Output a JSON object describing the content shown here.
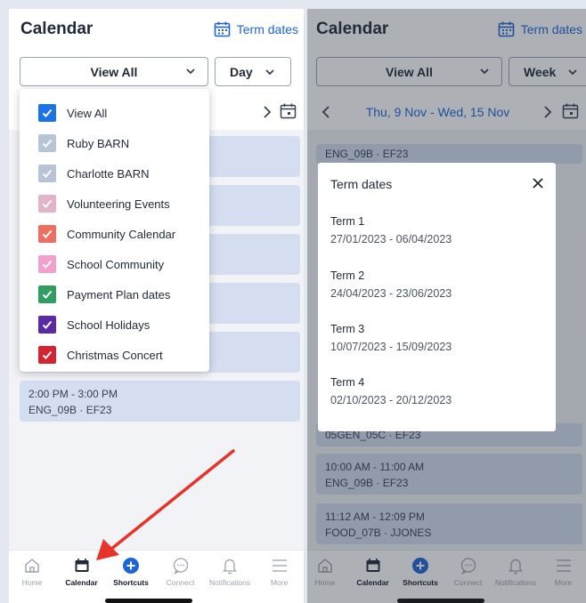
{
  "left": {
    "title": "Calendar",
    "term_link": "Term dates",
    "view_select": "View All",
    "mode_select": "Day",
    "dropdown_items": [
      {
        "label": "View All",
        "color": "#1a73e8",
        "checked": true
      },
      {
        "label": "Ruby BARN",
        "color": "#b7c3d6",
        "checked": true
      },
      {
        "label": "Charlotte BARN",
        "color": "#b7c3d6",
        "checked": true
      },
      {
        "label": "Volunteering Events",
        "color": "#e3b3c9",
        "checked": true
      },
      {
        "label": "Community Calendar",
        "color": "#ef6e60",
        "checked": true
      },
      {
        "label": "School Community",
        "color": "#f4a0cf",
        "checked": true
      },
      {
        "label": "Payment Plan dates",
        "color": "#2e9e62",
        "checked": true
      },
      {
        "label": "School Holidays",
        "color": "#5b2aa5",
        "checked": true
      },
      {
        "label": "Christmas Concert",
        "color": "#d5232f",
        "checked": true
      }
    ],
    "events": [
      {
        "time": "2:00 PM - 3:00 PM",
        "class": "ENG_09B · EF23"
      }
    ]
  },
  "right": {
    "title": "Calendar",
    "term_link": "Term dates",
    "view_select": "View All",
    "mode_select": "Week",
    "date_range": "Thu, 9 Nov - Wed, 15 Nov",
    "events": [
      {
        "time": "",
        "class": "ENG_09B · EF23"
      },
      {
        "time": "",
        "class": "05GEN_05C · EF23"
      },
      {
        "time": "10:00 AM - 11:00 AM",
        "class": "ENG_09B · EF23"
      },
      {
        "time": "11:12 AM - 12:09 PM",
        "class": "FOOD_07B · JJONES"
      }
    ],
    "modal": {
      "title": "Term dates",
      "terms": [
        {
          "name": "Term 1",
          "dates": "27/01/2023 - 06/04/2023"
        },
        {
          "name": "Term 2",
          "dates": "24/04/2023 - 23/06/2023"
        },
        {
          "name": "Term 3",
          "dates": "10/07/2023 - 15/09/2023"
        },
        {
          "name": "Term 4",
          "dates": "02/10/2023 - 20/12/2023"
        }
      ]
    }
  },
  "tabs": [
    {
      "label": "Home",
      "icon": "home-icon"
    },
    {
      "label": "Calendar",
      "icon": "calendar-icon"
    },
    {
      "label": "Shortcuts",
      "icon": "plus-circle-icon"
    },
    {
      "label": "Connect",
      "icon": "chat-bubble-icon"
    },
    {
      "label": "Notifications",
      "icon": "bell-icon"
    },
    {
      "label": "More",
      "icon": "menu-icon"
    }
  ],
  "colors": {
    "accent": "#1d64d8",
    "event_bg": "#d4def0",
    "arrow": "#e8332a"
  }
}
